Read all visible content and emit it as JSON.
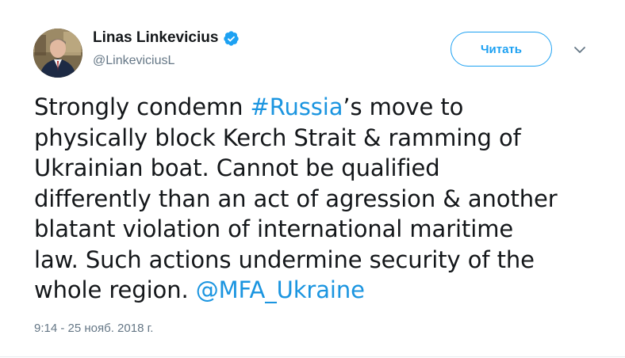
{
  "author": {
    "name": "Linas Linkevicius",
    "handle": "@LinkeviciusL",
    "verified_icon": "verified-badge-icon",
    "avatar_icon": "profile-photo-avatar"
  },
  "actions": {
    "follow_label": "Читать",
    "more_icon": "chevron-down-icon"
  },
  "tweet": {
    "text_lines": [
      {
        "before": "Strongly condemn ",
        "hashtag": "#Russia",
        "after": "’s move to"
      },
      {
        "text": "physically block Kerch Strait & ramming of"
      },
      {
        "text": "Ukrainian boat. Cannot be qualified"
      },
      {
        "text": "differently than an act of agression & another"
      },
      {
        "text": "blatant violation of international maritime"
      },
      {
        "text": "law. Such actions undermine security of the"
      },
      {
        "before": "whole region. ",
        "mention": "@MFA_Ukraine"
      }
    ],
    "timestamp": "9:14 - 25 нояб. 2018 г."
  },
  "colors": {
    "link": "#1b95e0",
    "accent": "#1da1f2",
    "text": "#14171a",
    "secondary_text": "#657786"
  }
}
